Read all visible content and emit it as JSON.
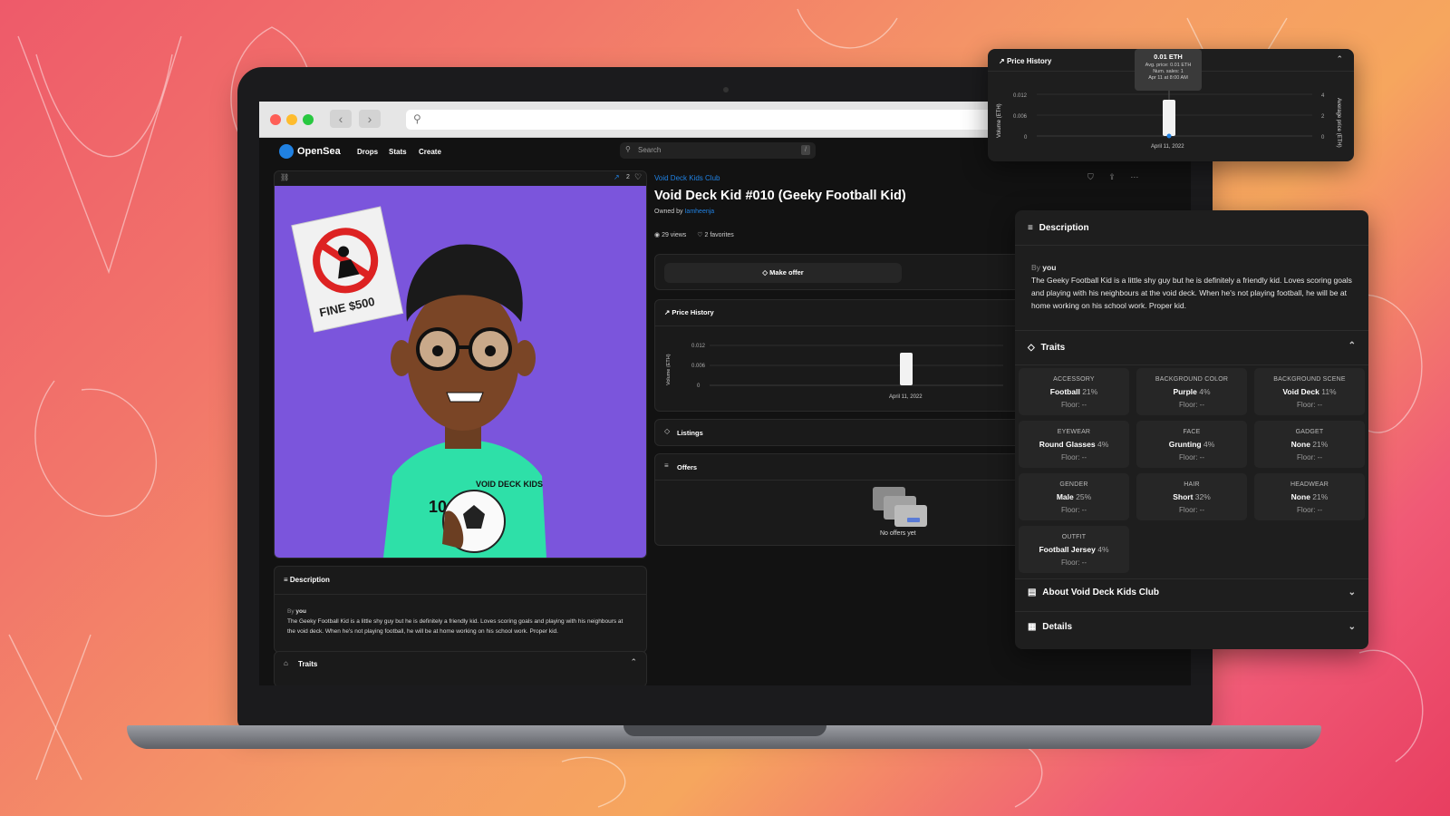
{
  "browser": {
    "controls": {
      "back": "‹",
      "forward": "›"
    },
    "url": ""
  },
  "nav": {
    "brand": "OpenSea",
    "links": [
      "Drops",
      "Stats",
      "Create"
    ],
    "search_placeholder": "Search",
    "search_shortcut": "/"
  },
  "item": {
    "collection": "Void Deck Kids Club",
    "title": "Void Deck Kid #010 (Geeky Football Kid)",
    "owned_by_label": "Owned by",
    "owner": "Iamheenja",
    "views": "29 views",
    "favorites": "2 favorites",
    "favorite_count": "2",
    "make_offer": "Make offer",
    "price_history_label": "Price History",
    "listings_label": "Listings",
    "offers_label": "Offers",
    "no_offers": "No offers yet",
    "chart_ylabel": "Volume (ETH)",
    "chart_y_ticks": [
      "0.012",
      "0.006",
      "0"
    ],
    "chart_x_label": "April 11, 2022",
    "sign_text": "FINE $500",
    "shirt_text": "VOID DECK KIDS",
    "shirt_number": "10"
  },
  "description": {
    "label": "Description",
    "by_label": "By",
    "by_value": "you",
    "text": "The Geeky Football Kid is a little shy guy but he is definitely a friendly kid. Loves scoring goals and playing with his neighbours at the void deck. When he's not playing football, he will be at home working on his school work. Proper kid."
  },
  "traits_label": "Traits",
  "traits": [
    {
      "type": "ACCESSORY",
      "value": "Football",
      "pct": "21%",
      "floor": "Floor: --"
    },
    {
      "type": "BACKGROUND COLOR",
      "value": "Purple",
      "pct": "4%",
      "floor": "Floor: --"
    },
    {
      "type": "BACKGROUND SCENE",
      "value": "Void Deck",
      "pct": "11%",
      "floor": "Floor: --"
    },
    {
      "type": "EYEWEAR",
      "value": "Round Glasses",
      "pct": "4%",
      "floor": "Floor: --"
    },
    {
      "type": "FACE",
      "value": "Grunting",
      "pct": "4%",
      "floor": "Floor: --"
    },
    {
      "type": "GADGET",
      "value": "None",
      "pct": "21%",
      "floor": "Floor: --"
    },
    {
      "type": "GENDER",
      "value": "Male",
      "pct": "25%",
      "floor": "Floor: --"
    },
    {
      "type": "HAIR",
      "value": "Short",
      "pct": "32%",
      "floor": "Floor: --"
    },
    {
      "type": "HEADWEAR",
      "value": "None",
      "pct": "21%",
      "floor": "Floor: --"
    },
    {
      "type": "OUTFIT",
      "value": "Football Jersey",
      "pct": "4%",
      "floor": "Floor: --"
    }
  ],
  "about_label": "About Void Deck Kids Club",
  "details_label": "Details",
  "price_popup": {
    "title": "Price History",
    "tooltip_price": "0.01 ETH",
    "tooltip_avg": "Avg. price: 0.01 ETH",
    "tooltip_sales": "Num. sales: 1",
    "tooltip_time": "Apr 11 at 8:00 AM",
    "left_axis_label": "Volume (ETH)",
    "right_axis_label": "Average price (ETH)",
    "left_ticks": [
      "0.012",
      "0.006",
      "0"
    ],
    "right_ticks": [
      "4",
      "2",
      "0"
    ],
    "x_label": "April 11, 2022"
  },
  "colors": {
    "accent": "#2081e2",
    "artwork_bg": "#7b55dc",
    "jersey": "#2ee0a8"
  }
}
